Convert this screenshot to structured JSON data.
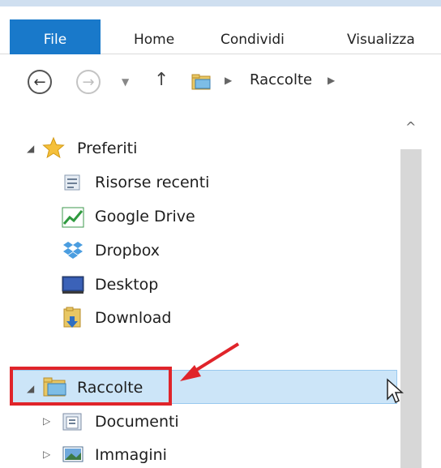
{
  "ribbon": {
    "tabs": [
      {
        "label": "File"
      },
      {
        "label": "Home"
      },
      {
        "label": "Condividi"
      },
      {
        "label": "Visualizza"
      }
    ]
  },
  "address": {
    "back": "back",
    "forward": "forward",
    "crumbs": [
      "Raccolte"
    ]
  },
  "nav": {
    "favorites": {
      "label": "Preferiti",
      "items": [
        {
          "label": "Risorse recenti",
          "icon": "recent-places-icon"
        },
        {
          "label": "Google Drive",
          "icon": "google-drive-icon"
        },
        {
          "label": "Dropbox",
          "icon": "dropbox-icon"
        },
        {
          "label": "Desktop",
          "icon": "desktop-icon"
        },
        {
          "label": "Download",
          "icon": "download-folder-icon"
        }
      ]
    },
    "libraries": {
      "label": "Raccolte",
      "items": [
        {
          "label": "Documenti",
          "icon": "documents-library-icon"
        },
        {
          "label": "Immagini",
          "icon": "pictures-library-icon"
        }
      ]
    }
  },
  "colors": {
    "accent": "#1979ca",
    "selection": "#cce5f8",
    "highlight_box": "#e0242a"
  }
}
